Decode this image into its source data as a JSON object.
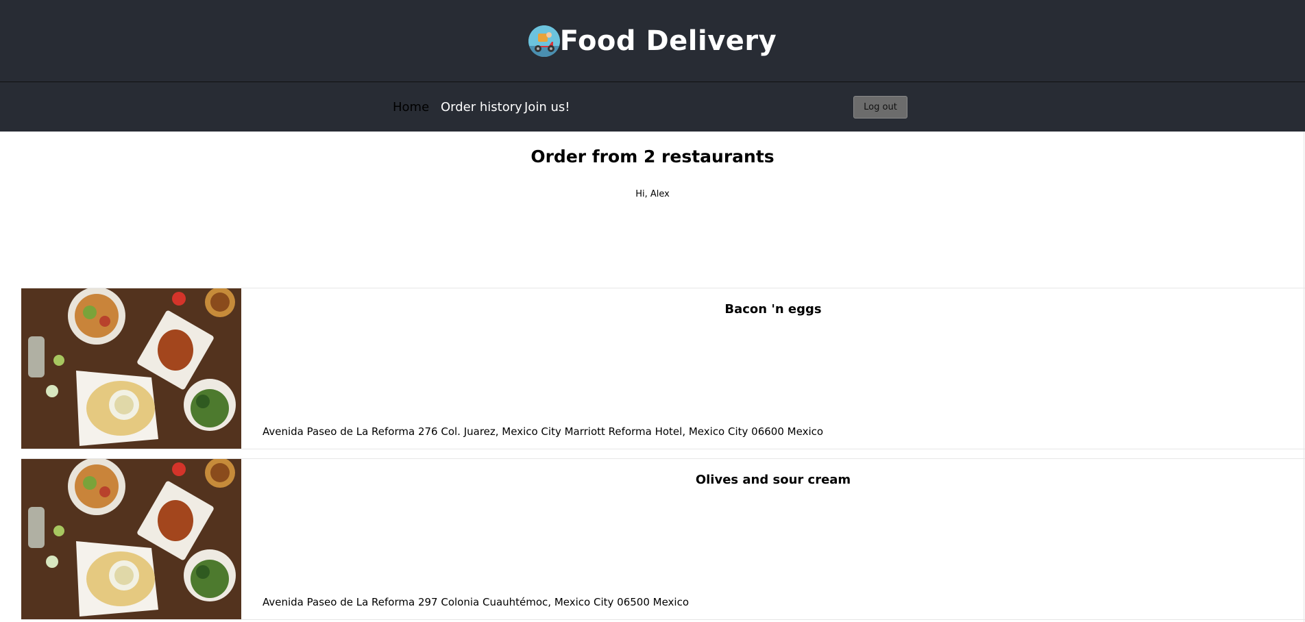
{
  "header": {
    "title": "Food Delivery",
    "logo_icon": "scooter-delivery-icon"
  },
  "nav": {
    "home": "Home",
    "order_history": "Order history",
    "join": "Join us!",
    "logout": "Log out"
  },
  "main": {
    "title": "Order from 2 restaurants",
    "greeting": "Hi, Alex"
  },
  "restaurants": [
    {
      "name": "Bacon 'n eggs",
      "address": "Avenida Paseo de La Reforma 276 Col. Juarez, Mexico City Marriott Reforma Hotel, Mexico City 06600 Mexico",
      "image": "food-table-photo"
    },
    {
      "name": "Olives and sour cream",
      "address": "Avenida Paseo de La Reforma 297 Colonia Cuauhtémoc, Mexico City 06500 Mexico",
      "image": "food-table-photo"
    }
  ],
  "colors": {
    "header_bg": "#282c34",
    "nav_text": "#ffffff",
    "logout_bg": "#6c6c6c"
  }
}
